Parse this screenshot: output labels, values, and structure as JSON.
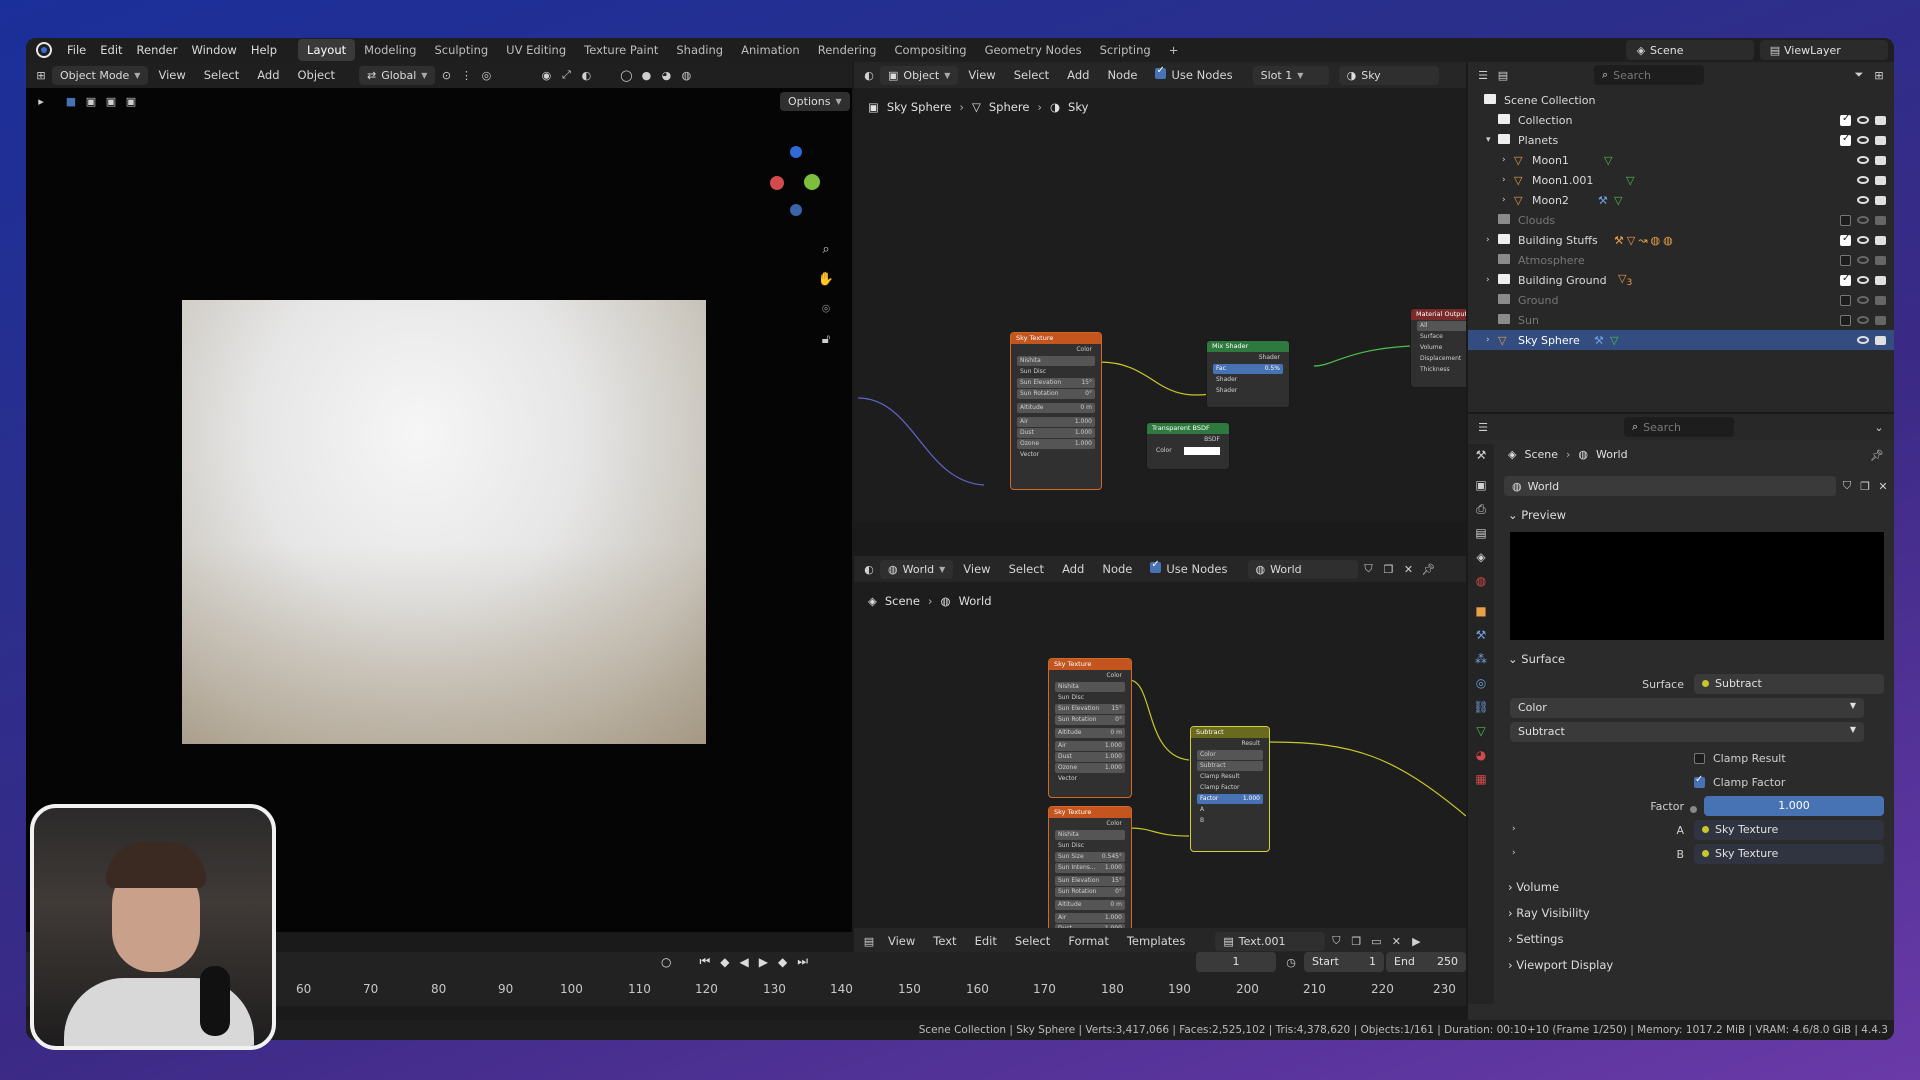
{
  "menubar": {
    "menus": [
      "File",
      "Edit",
      "Render",
      "Window",
      "Help"
    ],
    "workspaces": [
      "Layout",
      "Modeling",
      "Sculpting",
      "UV Editing",
      "Texture Paint",
      "Shading",
      "Animation",
      "Rendering",
      "Compositing",
      "Geometry Nodes",
      "Scripting"
    ],
    "add_tab": "+",
    "scene": "Scene",
    "view_layer": "ViewLayer"
  },
  "viewport": {
    "mode": "Object Mode",
    "menus": [
      "View",
      "Select",
      "Add",
      "Object"
    ],
    "transform": "Global",
    "options": "Options"
  },
  "shader_editor": {
    "type": "Object",
    "menus": [
      "View",
      "Select",
      "Add",
      "Node"
    ],
    "use_nodes": "Use Nodes",
    "slot": "Slot 1",
    "material": "Sky",
    "breadcrumb": [
      "Sky Sphere",
      "Sphere",
      "Sky"
    ],
    "nodes": {
      "sky_texture": "Sky Texture",
      "color": "Color",
      "nishita": "Nishita",
      "sun_disc": "Sun Disc",
      "sun_elevation": "Sun Elevation",
      "sun_elevation_val": "15°",
      "sun_rotation": "Sun Rotation",
      "sun_rotation_val": "0°",
      "altitude": "Altitude",
      "altitude_val": "0 m",
      "air": "Air",
      "air_val": "1.000",
      "dust": "Dust",
      "dust_val": "1.000",
      "ozone": "Ozone",
      "ozone_val": "1.000",
      "vector": "Vector",
      "mix_shader": "Mix Shader",
      "shader": "Shader",
      "fac": "Fac",
      "fac_val": "0.5%",
      "transparent": "Transparent BSDF",
      "bsdf": "BSDF",
      "material_output": "Material Output",
      "all": "All",
      "surface": "Surface",
      "volume": "Volume",
      "displacement": "Displacement",
      "thickness": "Thickness"
    }
  },
  "world_editor": {
    "type": "World",
    "menus": [
      "View",
      "Select",
      "Add",
      "Node"
    ],
    "use_nodes": "Use Nodes",
    "world": "World",
    "breadcrumb": [
      "Scene",
      "World"
    ],
    "nodes": {
      "sky_texture": "Sky Texture",
      "color": "Color",
      "nishita": "Nishita",
      "sun_disc": "Sun Disc",
      "sun_elevation": "Sun Elevation",
      "sun_elevation_val": "15°",
      "sun_rotation": "Sun Rotation",
      "sun_rotation_val": "0°",
      "altitude": "Altitude",
      "altitude_val": "0 m",
      "air": "Air",
      "air_val": "1.000",
      "dust": "Dust",
      "dust_val": "1.000",
      "ozone": "Ozone",
      "ozone_val": "1.000",
      "vector": "Vector",
      "sun_size": "Sun Size",
      "sun_size_val": "0.545°",
      "sun_intensity": "Sun Intens...",
      "sun_intensity_val": "1.000",
      "subtract": "Subtract",
      "result": "Result",
      "color_mode": "Color",
      "op": "Subtract",
      "clamp_result": "Clamp Result",
      "clamp_factor": "Clamp Factor",
      "factor": "Factor",
      "factor_val": "1.000",
      "a": "A",
      "b": "B"
    }
  },
  "text_editor": {
    "menus": [
      "View",
      "Text",
      "Edit",
      "Select",
      "Format",
      "Templates"
    ],
    "file": "Text.001"
  },
  "timeline": {
    "frame": "1",
    "start_label": "Start",
    "start": "1",
    "end_label": "End",
    "end": "250",
    "ticks": [
      "60",
      "70",
      "80",
      "90",
      "100",
      "110",
      "120",
      "130",
      "140",
      "150",
      "160",
      "170",
      "180",
      "190",
      "200",
      "210",
      "220",
      "230"
    ]
  },
  "outliner": {
    "search": "Search",
    "items": [
      {
        "label": "Scene Collection"
      },
      {
        "label": "Collection"
      },
      {
        "label": "Planets"
      },
      {
        "label": "Moon1"
      },
      {
        "label": "Moon1.001"
      },
      {
        "label": "Moon2"
      },
      {
        "label": "Clouds"
      },
      {
        "label": "Building Stuffs"
      },
      {
        "label": "Atmosphere"
      },
      {
        "label": "Building Ground"
      },
      {
        "label": "Ground"
      },
      {
        "label": "Sun"
      },
      {
        "label": "Sky Sphere"
      }
    ],
    "building_ground_count": "3"
  },
  "properties": {
    "search": "Search",
    "breadcrumb": [
      "Scene",
      "World"
    ],
    "world_name": "World",
    "preview": "Preview",
    "surface_panel": "Surface",
    "surface_label": "Surface",
    "surface_value": "Subtract",
    "color_mode": "Color",
    "operation": "Subtract",
    "clamp_result": "Clamp Result",
    "clamp_factor": "Clamp Factor",
    "factor_label": "Factor",
    "factor_value": "1.000",
    "a_label": "A",
    "a_value": "Sky Texture",
    "b_label": "B",
    "b_value": "Sky Texture",
    "volume": "Volume",
    "ray_visibility": "Ray Visibility",
    "settings": "Settings",
    "viewport_display": "Viewport Display"
  },
  "statusbar": "Scene Collection | Sky Sphere | Verts:3,417,066 | Faces:2,525,102 | Tris:4,378,620 | Objects:1/161 | Duration: 00:10+10 (Frame 1/250) | Memory: 1017.2 MiB | VRAM: 4.6/8.0 GiB | 4.4.3",
  "colors": {
    "accent": "#4772b3",
    "selection": "#334d80",
    "socket_color": "#c7c729",
    "socket_shader": "#4dc04d"
  }
}
